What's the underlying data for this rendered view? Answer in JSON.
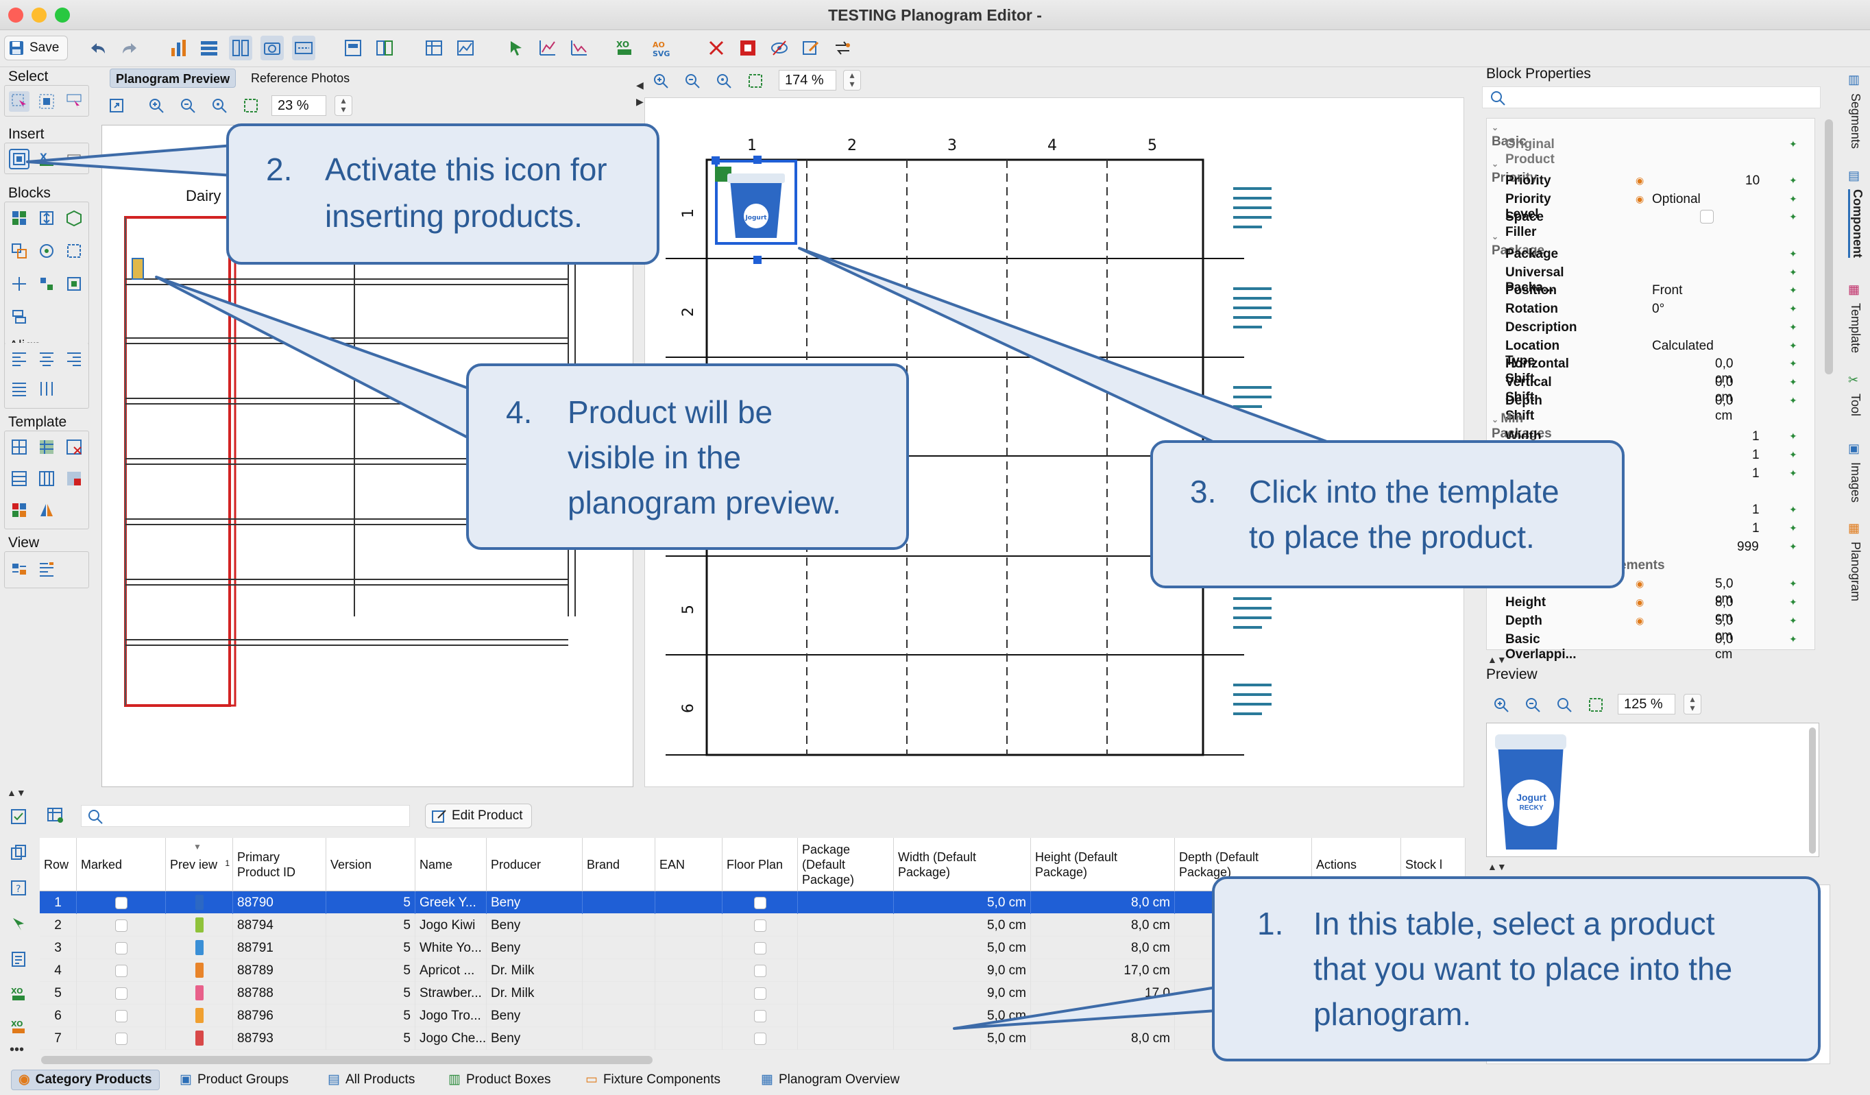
{
  "window": {
    "title": "TESTING Planogram Editor -"
  },
  "toolbar": {
    "save_label": "Save"
  },
  "left_palette": {
    "select_label": "Select",
    "insert_label": "Insert",
    "blocks_label": "Blocks",
    "align_label": "Align",
    "template_label": "Template",
    "view_label": "View"
  },
  "preview_panel": {
    "tabs": [
      "Planogram Preview",
      "Reference Photos"
    ],
    "zoom": "23 %",
    "shelf_label": "Dairy"
  },
  "template_panel": {
    "zoom": "174 %",
    "columns": [
      "1",
      "2",
      "3",
      "4",
      "5"
    ],
    "rows": [
      "1",
      "2",
      "5",
      "6"
    ],
    "product_label": "Jogurt"
  },
  "properties": {
    "title": "Block Properties",
    "sections": {
      "basic": "Basic",
      "priority": "Priority",
      "package": "Package",
      "min_packages": "Min Packages",
      "measurements_tail": "ements"
    },
    "rows": {
      "original_product": "Original Product",
      "priority": "Priority",
      "priority_value": "10",
      "priority_level": "Priority Level",
      "priority_level_value": "Optional",
      "space_filler": "Space Filler",
      "package": "Package",
      "universal_package": "Universal Packa...",
      "position": "Position",
      "position_value": "Front",
      "rotation": "Rotation",
      "rotation_value": "0°",
      "description": "Description",
      "location_type": "Location Type",
      "location_type_value": "Calculated",
      "horizontal_shift": "Horizontal Shift",
      "horizontal_shift_value": "0,0 cm",
      "vertical_shift": "Vertical Shift",
      "vertical_shift_value": "0,0 cm",
      "depth_shift": "Depth Shift",
      "depth_shift_value": "0,0 cm",
      "width": "Width",
      "min_values": [
        "1",
        "1",
        "1",
        "1",
        "1",
        "999"
      ],
      "meas_1_value": "5,0 cm",
      "height": "Height",
      "height_value": "8,0 cm",
      "depth": "Depth",
      "depth_value": "5,0 cm",
      "basic_overlapping": "Basic Overlappi...",
      "basic_overlapping_value": "0,0 cm"
    }
  },
  "mini_preview": {
    "title": "Preview",
    "zoom": "125 %",
    "product_label": "Jogurt",
    "product_sub": "RECKY"
  },
  "side_tabs": [
    "Segments",
    "Component",
    "Template",
    "Tool",
    "Images",
    "Planogram"
  ],
  "products_table": {
    "edit_button": "Edit Product",
    "columns": [
      "Row",
      "Marked",
      "Prev iew",
      "Primary Product ID",
      "Version",
      "Name",
      "Producer",
      "Brand",
      "EAN",
      "Floor Plan",
      "Package (Default Package)",
      "Width (Default Package)",
      "Height (Default Package)",
      "Depth (Default Package)",
      "Actions",
      "Stock l"
    ],
    "sort_indicator": "1",
    "rows": [
      {
        "row": "1",
        "id": "88790",
        "version": "5",
        "name": "Greek Y...",
        "producer": "Beny",
        "width": "5,0 cm",
        "height": "8,0 cm"
      },
      {
        "row": "2",
        "id": "88794",
        "version": "5",
        "name": "Jogo Kiwi",
        "producer": "Beny",
        "width": "5,0 cm",
        "height": "8,0 cm"
      },
      {
        "row": "3",
        "id": "88791",
        "version": "5",
        "name": "White Yo...",
        "producer": "Beny",
        "width": "5,0 cm",
        "height": "8,0 cm"
      },
      {
        "row": "4",
        "id": "88789",
        "version": "5",
        "name": "Apricot ...",
        "producer": "Dr. Milk",
        "width": "9,0 cm",
        "height": "17,0 cm"
      },
      {
        "row": "5",
        "id": "88788",
        "version": "5",
        "name": "Strawber...",
        "producer": "Dr. Milk",
        "width": "9,0 cm",
        "height": "17,0"
      },
      {
        "row": "6",
        "id": "88796",
        "version": "5",
        "name": "Jogo Tro...",
        "producer": "Beny",
        "width": "5,0 cm",
        "height": ""
      },
      {
        "row": "7",
        "id": "88793",
        "version": "5",
        "name": "Jogo Che...",
        "producer": "Beny",
        "width": "5,0 cm",
        "height": "8,0 cm"
      }
    ]
  },
  "bottom_tabs": [
    "Category Products",
    "Product Groups",
    "All Products",
    "Product Boxes",
    "Fixture Components",
    "Planogram Overview"
  ],
  "callouts": {
    "c1": {
      "num": "1.",
      "line1": "In this table, select a product",
      "line2": "that you want to place into the",
      "line3": "planogram."
    },
    "c2": {
      "num": "2.",
      "line1": "Activate this icon for",
      "line2": "inserting products."
    },
    "c3": {
      "num": "3.",
      "line1": "Click into the template",
      "line2": "to place the product."
    },
    "c4": {
      "num": "4.",
      "line1": "Product will be",
      "line2": "visible in the",
      "line3": "planogram preview."
    }
  },
  "colors": {
    "selection": "#1f5fd6",
    "callout_border": "#3d6ba8",
    "callout_fill": "#e4ebf5",
    "callout_text": "#2b5b96",
    "shelf_red": "#d22222"
  }
}
